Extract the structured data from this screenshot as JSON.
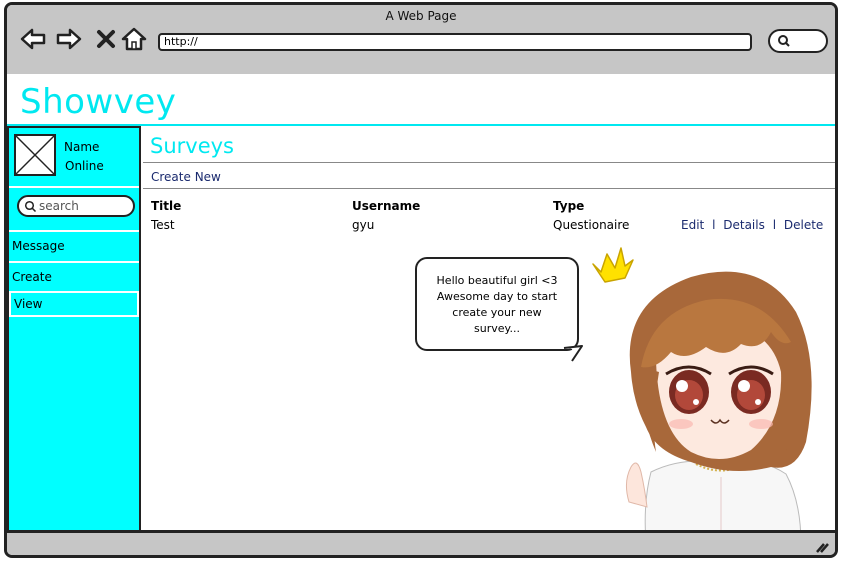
{
  "window": {
    "title": "A Web Page",
    "url": "http://"
  },
  "app": {
    "brand": "Showvey"
  },
  "profile": {
    "name": "Name",
    "status": "Online"
  },
  "sidebar": {
    "search_placeholder": "search",
    "items": [
      {
        "label": "Message"
      },
      {
        "label": "Create"
      },
      {
        "label": "View",
        "active": true
      }
    ]
  },
  "main": {
    "title": "Surveys",
    "create_new": "Create New",
    "columns": [
      "Title",
      "Username",
      "Type"
    ],
    "rows": [
      {
        "title": "Test",
        "username": "gyu",
        "type": "Questionaire"
      }
    ],
    "actions": {
      "edit": "Edit",
      "details": "Details",
      "delete": "Delete",
      "separator": "l"
    }
  },
  "bubble": {
    "lines": [
      "Hello beautiful girl <3",
      "Awesome day to start",
      "create your new",
      "survey..."
    ]
  },
  "colors": {
    "accent": "#00ffff",
    "brand": "#00e8f0",
    "chrome": "#c6c6c6",
    "link": "#1a2a6e"
  },
  "icons": [
    "back-arrow-icon",
    "forward-arrow-icon",
    "close-icon",
    "home-icon",
    "search-icon",
    "image-placeholder-icon",
    "crown-icon",
    "resize-grip-icon"
  ]
}
